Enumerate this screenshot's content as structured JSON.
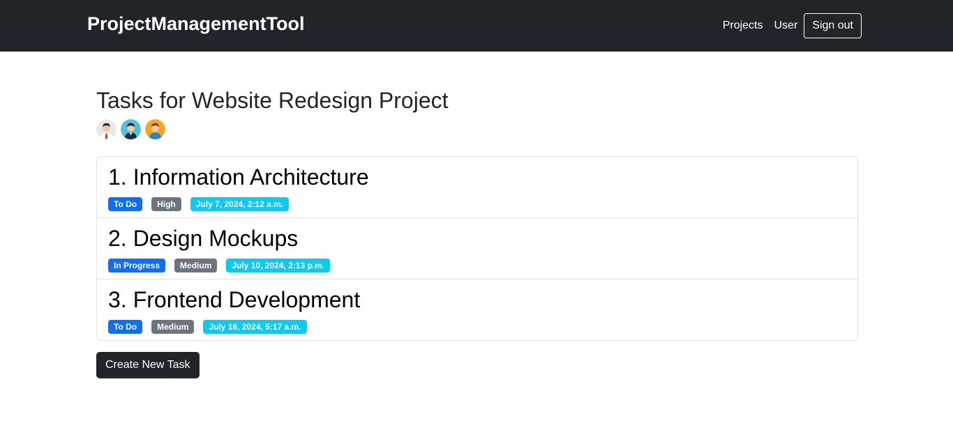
{
  "navbar": {
    "brand": "ProjectManagementTool",
    "links": [
      "Projects",
      "User"
    ],
    "signout_label": "Sign out",
    "background": "#212529"
  },
  "page": {
    "title": "Tasks for Website Redesign Project",
    "members": [
      {
        "icon": "avatar-man-red-tie-icon",
        "bg": "#e9e9e9",
        "accent": "#c0392b"
      },
      {
        "icon": "avatar-man-suit-icon",
        "bg": "#4fc3d9",
        "accent": "#1a2a4a"
      },
      {
        "icon": "avatar-man-orange-icon",
        "bg": "#f5a623",
        "accent": "#2c7fd1"
      }
    ]
  },
  "tasks": [
    {
      "number": "1.",
      "title": "Information Architecture",
      "status": "To Do",
      "priority": "High",
      "due": "July 7, 2024, 2:12 a.m."
    },
    {
      "number": "2.",
      "title": "Design Mockups",
      "status": "In Progress",
      "priority": "Medium",
      "due": "July 10, 2024, 2:13 p.m."
    },
    {
      "number": "3.",
      "title": "Frontend Development",
      "status": "To Do",
      "priority": "Medium",
      "due": "July 16, 2024, 5:17 a.m."
    }
  ],
  "colors": {
    "status_badge": "#0d6efd",
    "priority_badge": "#6c757d",
    "due_badge": "#0dcaf0"
  },
  "actions": {
    "create_task_label": "Create New Task"
  }
}
